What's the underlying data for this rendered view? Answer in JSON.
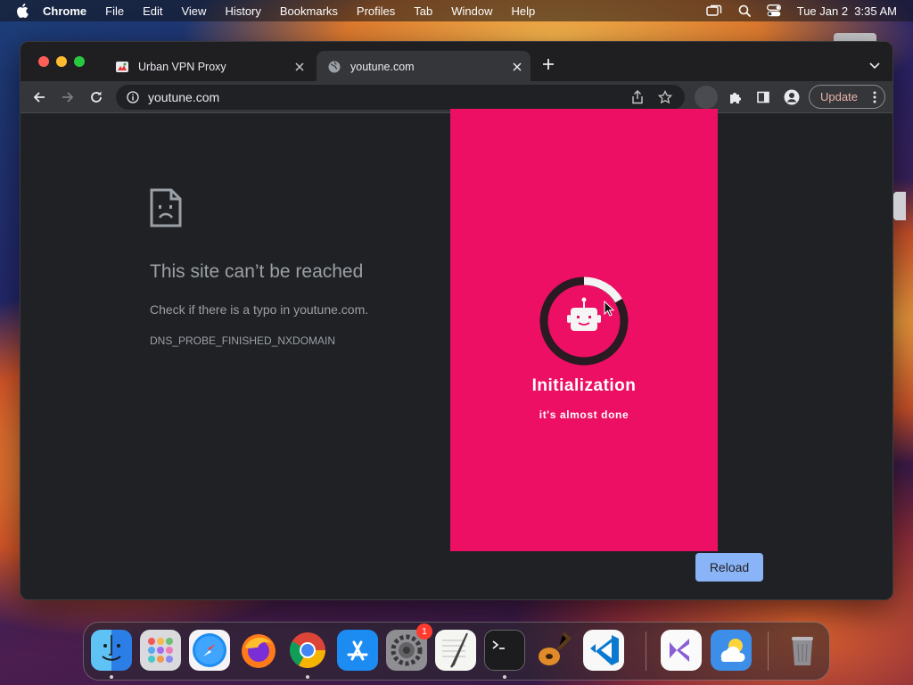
{
  "menubar": {
    "app_name": "Chrome",
    "menus": [
      "File",
      "Edit",
      "View",
      "History",
      "Bookmarks",
      "Profiles",
      "Tab",
      "Window",
      "Help"
    ],
    "datetime": "Tue Jan 2  3:35 AM"
  },
  "tabs": [
    {
      "title": "Urban VPN Proxy",
      "active": false
    },
    {
      "title": "youtune.com",
      "active": true
    }
  ],
  "toolbar": {
    "url": "youtune.com",
    "update_label": "Update"
  },
  "error_page": {
    "title": "This site can’t be reached",
    "message": "Check if there is a typo in youtune.com.",
    "code": "DNS_PROBE_FINISHED_NXDOMAIN",
    "reload_label": "Reload"
  },
  "vpn_popup": {
    "title": "Initialization",
    "subtitle": "it's almost done",
    "background_color": "#ed0f63"
  },
  "dock": {
    "apps": [
      "finder-icon",
      "launchpad-icon",
      "safari-icon",
      "firefox-icon",
      "chrome-icon",
      "app-store-icon",
      "system-settings-icon",
      "textedit-icon",
      "terminal-icon",
      "garageband-icon",
      "vscode-icon",
      "visual-studio-icon",
      "weather-icon",
      "trash-icon"
    ],
    "settings_badge": "1"
  }
}
